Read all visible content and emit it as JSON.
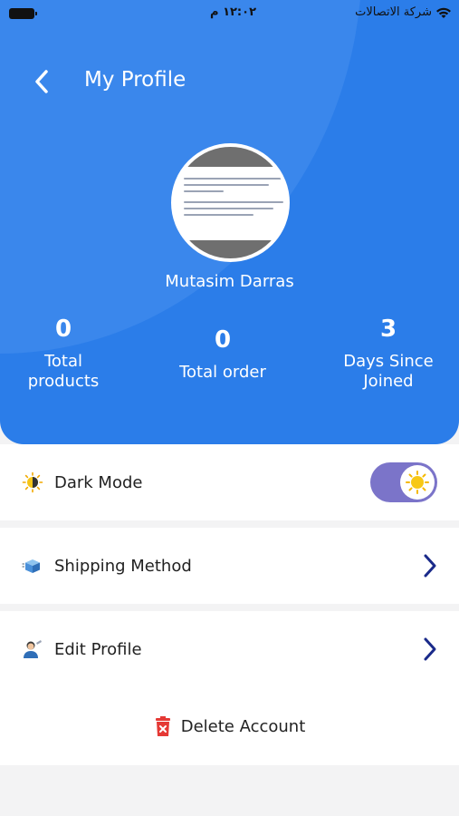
{
  "status_bar": {
    "time": "١٢:٠٢ م",
    "carrier": "شركة الاتصالات"
  },
  "header": {
    "title": "My Profile",
    "user_name": "Mutasim Darras"
  },
  "stats": [
    {
      "value": "0",
      "label_line1": "Total",
      "label_line2": "products"
    },
    {
      "value": "0",
      "label_line1": "Total order",
      "label_line2": ""
    },
    {
      "value": "3",
      "label_line1": "Days Since",
      "label_line2": "Joined"
    }
  ],
  "settings": {
    "dark_mode_label": "Dark Mode",
    "shipping_label": "Shipping Method",
    "edit_profile_label": "Edit Profile",
    "delete_label": "Delete Account"
  },
  "colors": {
    "header_blue": "#2b7de9",
    "toggle_purple": "#7b74c9",
    "chevron_navy": "#1a2a8a",
    "delete_red": "#e53935"
  },
  "icons": {
    "back": "chevron-left-icon",
    "dark_mode": "sun-moon-icon",
    "shipping": "box-icon",
    "edit": "user-edit-icon",
    "delete": "trash-icon"
  }
}
